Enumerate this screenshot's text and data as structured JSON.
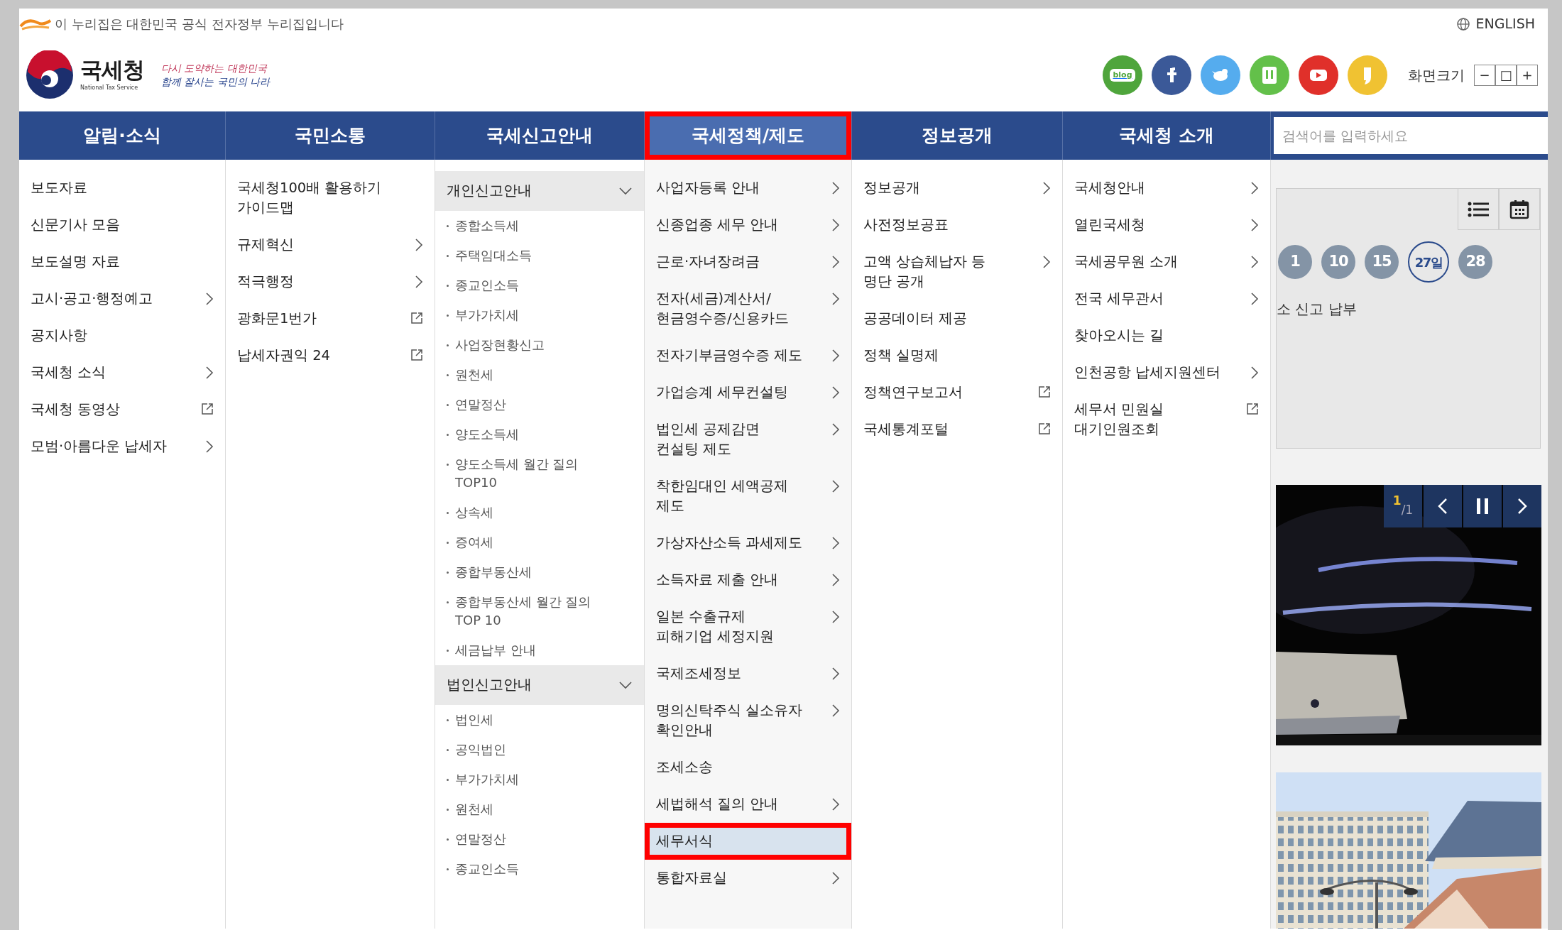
{
  "gov_banner": {
    "text": "이 누리집은 대한민국 공식 전자정부 누리집입니다"
  },
  "language_link": "ENGLISH",
  "logo": {
    "name": "국세청",
    "subtitle": "National Tax Service"
  },
  "slogan": [
    "다시 도약하는 대한민국",
    "함께 잘사는 국민의 나라"
  ],
  "social_links": [
    {
      "kind": "blog",
      "label": "blog",
      "color": "#4fa53c"
    },
    {
      "kind": "facebook",
      "color": "#3b5998"
    },
    {
      "kind": "twitter",
      "color": "#55acee"
    },
    {
      "kind": "post",
      "color": "#63c04a"
    },
    {
      "kind": "youtube",
      "color": "#e0302a"
    },
    {
      "kind": "story",
      "color": "#f0c232"
    }
  ],
  "font_size": {
    "label": "화면크기",
    "buttons": [
      "−",
      "□",
      "+"
    ]
  },
  "search": {
    "placeholder": "검색어를 입력하세요"
  },
  "menu": [
    {
      "title": "알림·소식",
      "selected": false,
      "marked": false,
      "items": [
        {
          "label": "보도자료",
          "kind": "plain"
        },
        {
          "label": "신문기사 모음",
          "kind": "plain"
        },
        {
          "label": "보도설명 자료",
          "kind": "plain"
        },
        {
          "label": "고시·공고·행정예고",
          "kind": "arrow"
        },
        {
          "label": "공지사항",
          "kind": "plain"
        },
        {
          "label": "국세청 소식",
          "kind": "arrow"
        },
        {
          "label": "국세청 동영상",
          "kind": "external"
        },
        {
          "label": "모범·아름다운 납세자",
          "kind": "arrow"
        }
      ]
    },
    {
      "title": "국민소통",
      "selected": false,
      "marked": false,
      "items": [
        {
          "label": "국세청100배 활용하기\n가이드맵",
          "kind": "plain"
        },
        {
          "label": "규제혁신",
          "kind": "arrow"
        },
        {
          "label": "적극행정",
          "kind": "arrow"
        },
        {
          "label": "광화문1번가",
          "kind": "external"
        },
        {
          "label": "납세자권익 24",
          "kind": "external"
        }
      ]
    },
    {
      "title": "국세신고안내",
      "selected": false,
      "marked": false,
      "items": [
        {
          "label": "개인신고안내",
          "kind": "group",
          "expanded": true,
          "children": [
            {
              "label": "종합소득세"
            },
            {
              "label": "주택임대소득"
            },
            {
              "label": "종교인소득"
            },
            {
              "label": "부가가치세"
            },
            {
              "label": "사업장현황신고"
            },
            {
              "label": "원천세"
            },
            {
              "label": "연말정산"
            },
            {
              "label": "양도소득세"
            },
            {
              "label": "양도소득세 월간 질의\nTOP10"
            },
            {
              "label": "상속세"
            },
            {
              "label": "증여세"
            },
            {
              "label": "종합부동산세"
            },
            {
              "label": "종합부동산세 월간 질의\nTOP 10"
            },
            {
              "label": "세금납부 안내"
            }
          ]
        },
        {
          "label": "법인신고안내",
          "kind": "group",
          "expanded": true,
          "children": [
            {
              "label": "법인세"
            },
            {
              "label": "공익법인"
            },
            {
              "label": "부가가치세"
            },
            {
              "label": "원천세"
            },
            {
              "label": "연말정산"
            },
            {
              "label": "종교인소득"
            }
          ]
        }
      ]
    },
    {
      "title": "국세정책/제도",
      "selected": true,
      "marked": true,
      "items": [
        {
          "label": "사업자등록 안내",
          "kind": "arrow",
          "selected": false,
          "marked": false
        },
        {
          "label": "신종업종 세무 안내",
          "kind": "arrow",
          "selected": false,
          "marked": false
        },
        {
          "label": "근로·자녀장려금",
          "kind": "arrow",
          "selected": false,
          "marked": false
        },
        {
          "label": "전자(세금)계산서/\n현금영수증/신용카드",
          "kind": "arrow",
          "selected": false,
          "marked": false
        },
        {
          "label": "전자기부금영수증 제도",
          "kind": "arrow",
          "selected": false,
          "marked": false
        },
        {
          "label": "가업승계 세무컨설팅",
          "kind": "arrow",
          "selected": false,
          "marked": false
        },
        {
          "label": "법인세 공제감면\n컨설팅 제도",
          "kind": "arrow",
          "selected": false,
          "marked": false
        },
        {
          "label": "착한임대인 세액공제\n제도",
          "kind": "arrow",
          "selected": false,
          "marked": false
        },
        {
          "label": "가상자산소득 과세제도",
          "kind": "arrow",
          "selected": false,
          "marked": false
        },
        {
          "label": "소득자료 제출 안내",
          "kind": "arrow",
          "selected": false,
          "marked": false
        },
        {
          "label": "일본 수출규제\n피해기업 세정지원",
          "kind": "arrow",
          "selected": false,
          "marked": false
        },
        {
          "label": "국제조세정보",
          "kind": "arrow",
          "selected": false,
          "marked": false
        },
        {
          "label": "명의신탁주식 실소유자\n확인안내",
          "kind": "arrow",
          "selected": false,
          "marked": false
        },
        {
          "label": "조세소송",
          "kind": "plain",
          "selected": false,
          "marked": false
        },
        {
          "label": "세법해석 질의 안내",
          "kind": "arrow",
          "selected": false,
          "marked": false
        },
        {
          "label": "세무서식",
          "kind": "plain",
          "selected": true,
          "marked": true
        },
        {
          "label": "통합자료실",
          "kind": "arrow",
          "selected": false,
          "marked": false
        }
      ]
    },
    {
      "title": "정보공개",
      "selected": false,
      "marked": false,
      "items": [
        {
          "label": "정보공개",
          "kind": "arrow"
        },
        {
          "label": "사전정보공표",
          "kind": "plain"
        },
        {
          "label": "고액 상습체납자 등\n명단 공개",
          "kind": "arrow"
        },
        {
          "label": "공공데이터 제공",
          "kind": "plain"
        },
        {
          "label": "정책 실명제",
          "kind": "plain"
        },
        {
          "label": "정책연구보고서",
          "kind": "external"
        },
        {
          "label": "국세통계포털",
          "kind": "external"
        }
      ]
    },
    {
      "title": "국세청 소개",
      "selected": false,
      "marked": false,
      "items": [
        {
          "label": "국세청안내",
          "kind": "arrow"
        },
        {
          "label": "열린국세청",
          "kind": "arrow"
        },
        {
          "label": "국세공무원 소개",
          "kind": "arrow"
        },
        {
          "label": "전국 세무관서",
          "kind": "arrow"
        },
        {
          "label": "찾아오시는 길",
          "kind": "plain"
        },
        {
          "label": "인천공항 납세지원센터",
          "kind": "arrow"
        },
        {
          "label": "세무서 민원실\n대기인원조회",
          "kind": "external"
        }
      ]
    }
  ],
  "calendar": {
    "dates": [
      {
        "label": "1",
        "selected": false
      },
      {
        "label": "10",
        "selected": false
      },
      {
        "label": "15",
        "selected": false
      },
      {
        "label": "27일",
        "selected": true
      },
      {
        "label": "28",
        "selected": false
      }
    ],
    "event_text": "소 신고 납부"
  },
  "banner": {
    "counter_current": "1",
    "counter_total": "/1",
    "playing": true,
    "kind": "picture"
  },
  "photo": {
    "kind": "picture"
  }
}
